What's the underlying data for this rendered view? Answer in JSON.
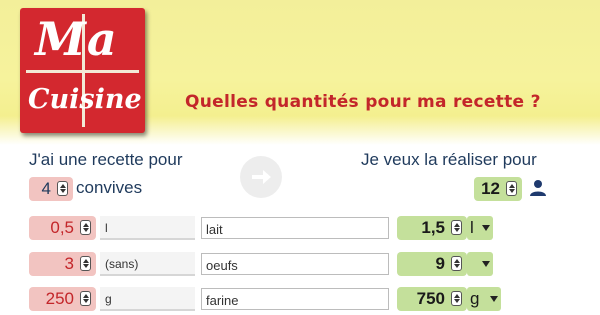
{
  "logo": {
    "line1": "Ma",
    "line2": "Cuisine"
  },
  "header": {
    "tagline": "Quelles quantités pour ma recette ?"
  },
  "converter": {
    "source_label": "J'ai une recette pour",
    "target_label": "Je veux la réaliser pour",
    "source_guests": "4",
    "guests_label": "convives",
    "target_guests": "12"
  },
  "ingredients": [
    {
      "qty": "0,5",
      "unit": "l",
      "name": "lait",
      "result": "1,5",
      "result_unit": "l"
    },
    {
      "qty": "3",
      "unit": "(sans)",
      "name": "oeufs",
      "result": "9",
      "result_unit": ""
    },
    {
      "qty": "250",
      "unit": "g",
      "name": "farine",
      "result": "750",
      "result_unit": "g"
    }
  ],
  "icons": {
    "arrow": "arrow-right-icon",
    "person": "person-icon"
  },
  "colors": {
    "brand_red": "#d3282f",
    "header_yellow": "#f3ef9a",
    "source_pink": "#f2c4c1",
    "target_green": "#c4e09b"
  }
}
